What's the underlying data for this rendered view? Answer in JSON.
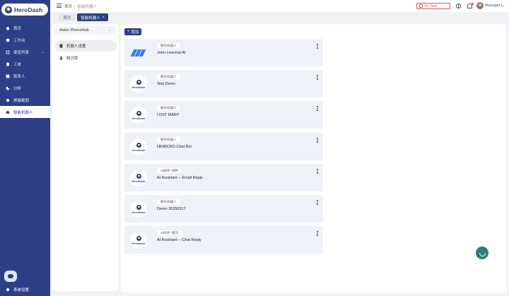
{
  "brand": {
    "name": "HeroDash"
  },
  "sidebar": {
    "items": [
      {
        "label": "首页",
        "icon": "home-icon"
      },
      {
        "label": "工作台",
        "icon": "dashboard-icon"
      },
      {
        "label": "渠道列表",
        "icon": "grid-icon",
        "has_children": true
      },
      {
        "label": "工单",
        "icon": "ticket-icon"
      },
      {
        "label": "联系人",
        "icon": "contacts-icon"
      },
      {
        "label": "分析",
        "icon": "chart-icon"
      },
      {
        "label": "屏蔽截图",
        "icon": "block-icon"
      },
      {
        "label": "智能机器人",
        "icon": "robot-icon",
        "active": true
      }
    ],
    "footer": {
      "label": "系统设置"
    }
  },
  "header": {
    "breadcrumb": {
      "home": "首页",
      "separator": "/",
      "current": "智能机器人"
    },
    "status": {
      "value": "On Task",
      "color": "#e05050"
    },
    "user": {
      "name": "Manager1"
    }
  },
  "tabs": [
    {
      "label": "首页",
      "active": false
    },
    {
      "label": "智能机器人",
      "active": true,
      "close": "×"
    }
  ],
  "left_panel": {
    "phone_select": {
      "value": "Aiden PhoneHub"
    },
    "items": [
      {
        "label": "机器人设置",
        "active": true
      },
      {
        "label": "知识库",
        "active": false
      }
    ]
  },
  "main": {
    "add_button": {
      "plus": "+",
      "label": "增加"
    },
    "cards": [
      {
        "tag": "聊天机器人",
        "title": "John Livechat AI",
        "logo": "stripes"
      },
      {
        "tag": "聊天机器人",
        "title": "Test Demo",
        "logo": "herodash"
      },
      {
        "tag": "聊天机器人",
        "title": "LOST MARY",
        "logo": "herodash"
      },
      {
        "tag": "聊天机器人",
        "title": "HKMICRO Chat Bot",
        "logo": "herodash"
      },
      {
        "tag": "AI助手--邮件",
        "title": "AI Assistant -- Email Reply",
        "logo": "herodash"
      },
      {
        "tag": "聊天机器人",
        "title": "Demo 20250317",
        "logo": "herodash"
      },
      {
        "tag": "AI助手--聊天",
        "title": "AI Assistant -- Chat Reply",
        "logo": "herodash"
      }
    ],
    "logo_text": "HeroDash"
  },
  "colors": {
    "brand": "#2d3f87",
    "accent": "#3a7be0",
    "fab": "#2e7d76"
  }
}
